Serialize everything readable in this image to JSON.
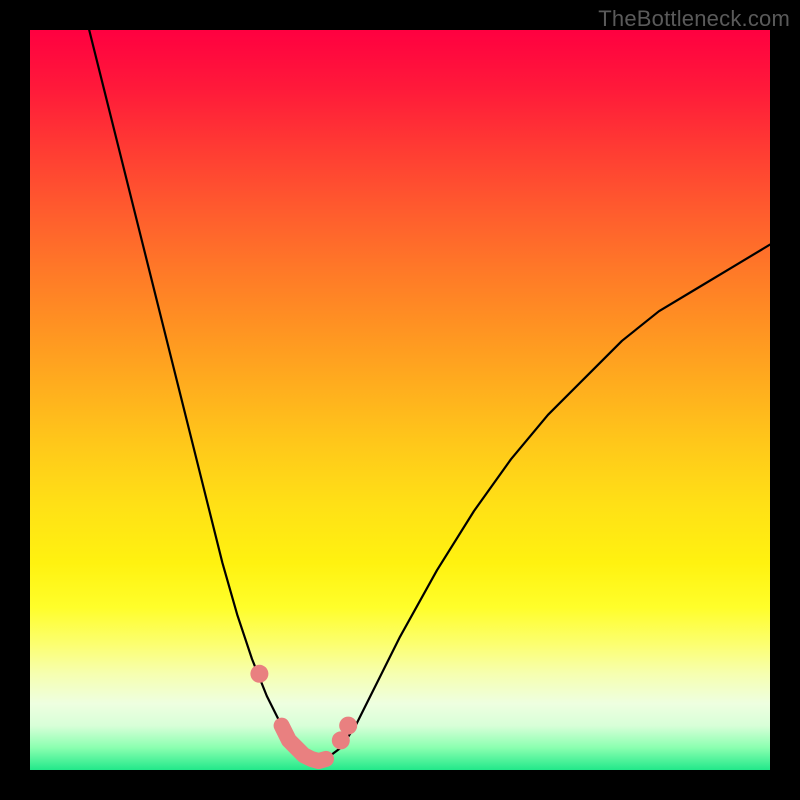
{
  "watermark": "TheBottleneck.com",
  "colors": {
    "frame_bg": "#000000",
    "gradient_top": "#ff0040",
    "gradient_bottom": "#22e88a",
    "curve": "#000000",
    "markers": "#e98080",
    "watermark_text": "#5a5a5a"
  },
  "chart_data": {
    "type": "line",
    "title": "",
    "xlabel": "",
    "ylabel": "",
    "xlim": [
      0,
      100
    ],
    "ylim": [
      0,
      100
    ],
    "grid": false,
    "legend": "none",
    "series": [
      {
        "name": "bottleneck-curve",
        "x": [
          8,
          10,
          12,
          14,
          16,
          18,
          20,
          22,
          24,
          26,
          28,
          30,
          32,
          34,
          35,
          36,
          37,
          38,
          39,
          40,
          42,
          44,
          46,
          48,
          50,
          55,
          60,
          65,
          70,
          75,
          80,
          85,
          90,
          95,
          100
        ],
        "values": [
          100,
          92,
          84,
          76,
          68,
          60,
          52,
          44,
          36,
          28,
          21,
          15,
          10,
          6,
          4,
          3,
          2,
          1.5,
          1.2,
          1.5,
          3,
          6,
          10,
          14,
          18,
          27,
          35,
          42,
          48,
          53,
          58,
          62,
          65,
          68,
          71
        ]
      }
    ],
    "annotations": [
      {
        "name": "highlight-flat-bottom",
        "x_range": [
          33,
          41
        ],
        "note": "salmon highlighted segment near minimum"
      },
      {
        "name": "highlight-dot-left",
        "x": 31,
        "y": 13
      },
      {
        "name": "highlight-dot-right-1",
        "x": 42,
        "y": 4
      },
      {
        "name": "highlight-dot-right-2",
        "x": 43,
        "y": 6
      }
    ],
    "background": "vertical rainbow gradient red→yellow→green"
  }
}
